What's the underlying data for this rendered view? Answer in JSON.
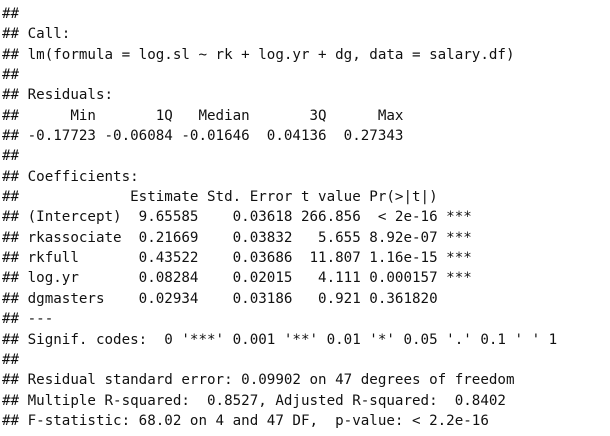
{
  "output_lines": [
    "##",
    "## Call:",
    "## lm(formula = log.sl ~ rk + log.yr + dg, data = salary.df)",
    "##",
    "## Residuals:",
    "##      Min       1Q   Median       3Q      Max",
    "## -0.17723 -0.06084 -0.01646  0.04136  0.27343",
    "##",
    "## Coefficients:",
    "##             Estimate Std. Error t value Pr(>|t|)",
    "## (Intercept)  9.65585    0.03618 266.856  < 2e-16 ***",
    "## rkassociate  0.21669    0.03832   5.655 8.92e-07 ***",
    "## rkfull       0.43522    0.03686  11.807 1.16e-15 ***",
    "## log.yr       0.08284    0.02015   4.111 0.000157 ***",
    "## dgmasters    0.02934    0.03186   0.921 0.361820",
    "## ---",
    "## Signif. codes:  0 '***' 0.001 '**' 0.01 '*' 0.05 '.' 0.1 ' ' 1",
    "##",
    "## Residual standard error: 0.09902 on 47 degrees of freedom",
    "## Multiple R-squared:  0.8527, Adjusted R-squared:  0.8402",
    "## F-statistic: 68.02 on 4 and 47 DF,  p-value: < 2.2e-16"
  ]
}
